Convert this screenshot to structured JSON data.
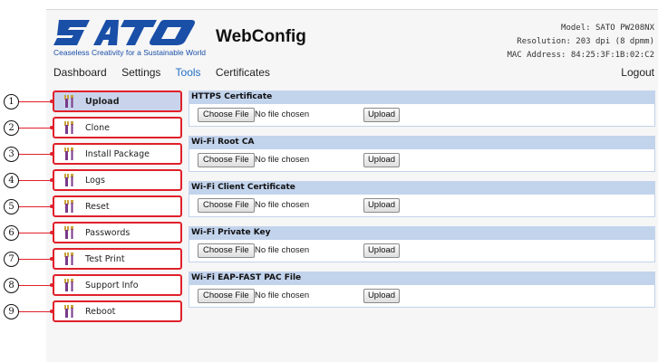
{
  "brand": {
    "logo_text": "SATO",
    "tagline": "Ceaseless Creativity for a Sustainable World",
    "logo_color": "#1a4fa8"
  },
  "app_title": "WebConfig",
  "device": {
    "model": "Model: SATO PW208NX",
    "resolution": "Resolution: 203 dpi (8 dpmm)",
    "mac": "MAC Address: 84:25:3F:1B:02:C2"
  },
  "nav": {
    "items": [
      "Dashboard",
      "Settings",
      "Tools",
      "Certificates"
    ],
    "active": "Tools",
    "logout": "Logout"
  },
  "menu": {
    "items": [
      {
        "num": "1",
        "label": "Upload",
        "icon": "tools-icon",
        "active": true
      },
      {
        "num": "2",
        "label": "Clone",
        "icon": "tools-icon",
        "active": false
      },
      {
        "num": "3",
        "label": "Install Package",
        "icon": "tools-icon",
        "active": false
      },
      {
        "num": "4",
        "label": "Logs",
        "icon": "tools-icon",
        "active": false
      },
      {
        "num": "5",
        "label": "Reset",
        "icon": "tools-icon",
        "active": false
      },
      {
        "num": "6",
        "label": "Passwords",
        "icon": "tools-icon",
        "active": false
      },
      {
        "num": "7",
        "label": "Test Print",
        "icon": "tools-icon",
        "active": false
      },
      {
        "num": "8",
        "label": "Support Info",
        "icon": "tools-icon",
        "active": false
      },
      {
        "num": "9",
        "label": "Reboot",
        "icon": "tools-icon",
        "active": false
      }
    ],
    "callout_numerals": [
      "①",
      "②",
      "③",
      "④",
      "⑤",
      "⑥",
      "⑦",
      "⑧",
      "⑨"
    ],
    "highlight_color": "#e0202a"
  },
  "certificates": {
    "choose_label": "Choose File",
    "no_file": "No file chosen",
    "upload_label": "Upload",
    "sections": [
      {
        "title": "HTTPS Certificate"
      },
      {
        "title": "Wi-Fi Root CA"
      },
      {
        "title": "Wi-Fi Client Certificate"
      },
      {
        "title": "Wi-Fi Private Key"
      },
      {
        "title": "Wi-Fi EAP-FAST PAC File"
      }
    ]
  },
  "colors": {
    "section_header": "#c2d3ec",
    "active_menu": "#c9d4ec",
    "nav_active": "#1f6fc4"
  }
}
